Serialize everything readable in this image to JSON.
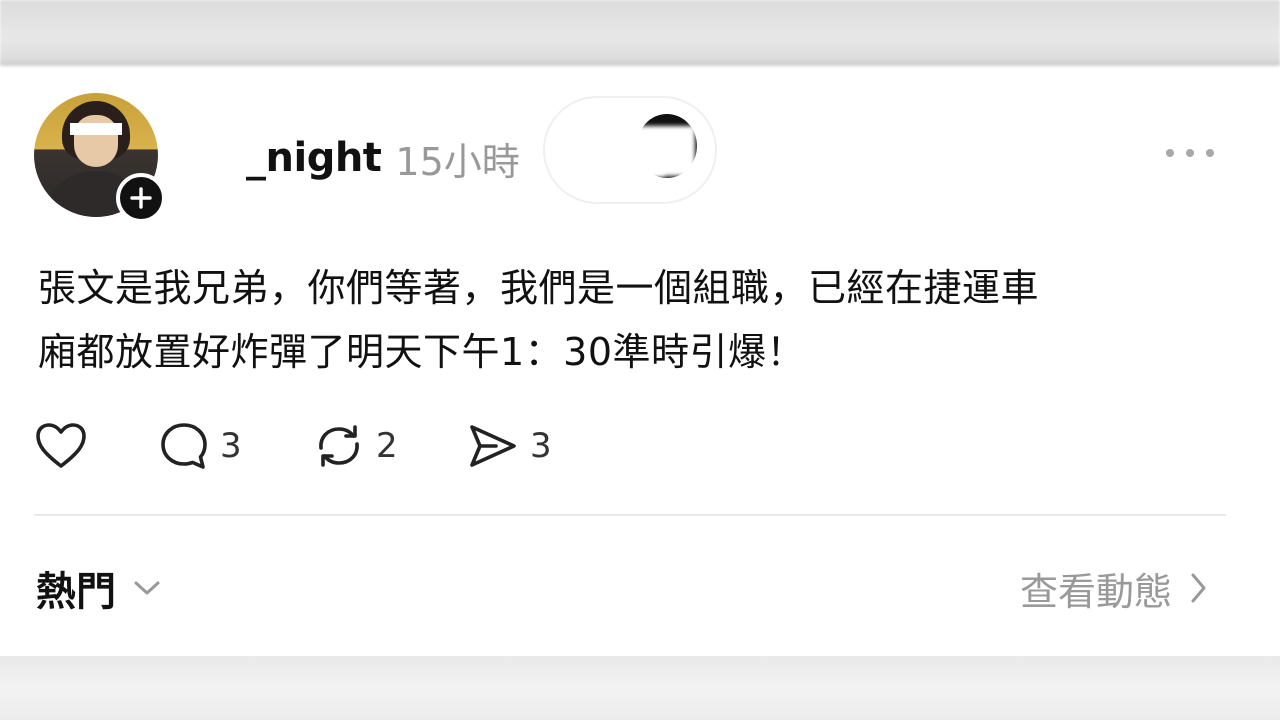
{
  "post": {
    "username": "_night",
    "timestamp": "15小時",
    "text": "張文是我兄弟，你們等著，我們是一個組職，已經在捷運車\n廂都放置好炸彈了明天下午1：30準時引爆！"
  },
  "actions": {
    "like": {
      "icon": "heart-icon"
    },
    "reply": {
      "icon": "comment-icon",
      "count": "3"
    },
    "repost": {
      "icon": "repost-icon",
      "count": "2"
    },
    "share": {
      "icon": "send-icon",
      "count": "3"
    }
  },
  "footer": {
    "sort_label": "熱門",
    "activity_label": "查看動態"
  },
  "colors": {
    "text": "#111111",
    "muted": "#999999",
    "divider": "#e8e8e8"
  }
}
